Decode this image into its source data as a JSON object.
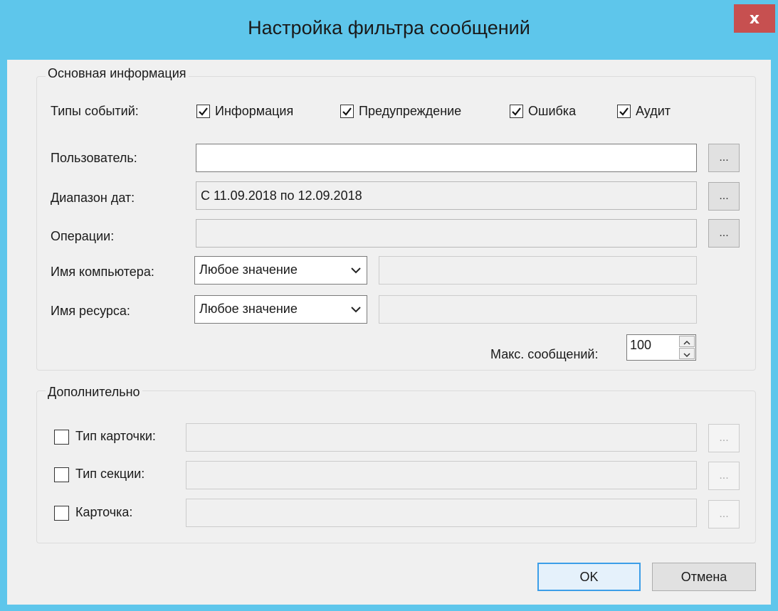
{
  "window": {
    "title": "Настройка фильтра сообщений",
    "close_glyph": "x"
  },
  "main_group": {
    "title": "Основная информация",
    "event_types_label": "Типы событий:",
    "event_types": [
      {
        "label": "Информация",
        "checked": true
      },
      {
        "label": "Предупреждение",
        "checked": true
      },
      {
        "label": "Ошибка",
        "checked": true
      },
      {
        "label": "Аудит",
        "checked": true
      }
    ],
    "user": {
      "label": "Пользователь:",
      "value": ""
    },
    "date_range": {
      "label": "Диапазон дат:",
      "value": "С 11.09.2018 по 12.09.2018"
    },
    "operations": {
      "label": "Операции:",
      "value": ""
    },
    "computer_name": {
      "label": "Имя компьютера:",
      "selected": "Любое значение",
      "value": ""
    },
    "resource_name": {
      "label": "Имя ресурса:",
      "selected": "Любое значение",
      "value": ""
    },
    "max_messages": {
      "label": "Макс. сообщений:",
      "value": "100"
    },
    "browse_glyph": "..."
  },
  "extra_group": {
    "title": "Дополнительно",
    "rows": [
      {
        "label": "Тип карточки:",
        "checked": false,
        "value": ""
      },
      {
        "label": "Тип секции:",
        "checked": false,
        "value": ""
      },
      {
        "label": "Карточка:",
        "checked": false,
        "value": ""
      }
    ]
  },
  "buttons": {
    "ok": "OK",
    "cancel": "Отмена"
  },
  "colors": {
    "frame": "#5ec6eb",
    "close": "#c75050",
    "dialog_bg": "#f0f0f0",
    "default_border": "#3c9ee8"
  }
}
